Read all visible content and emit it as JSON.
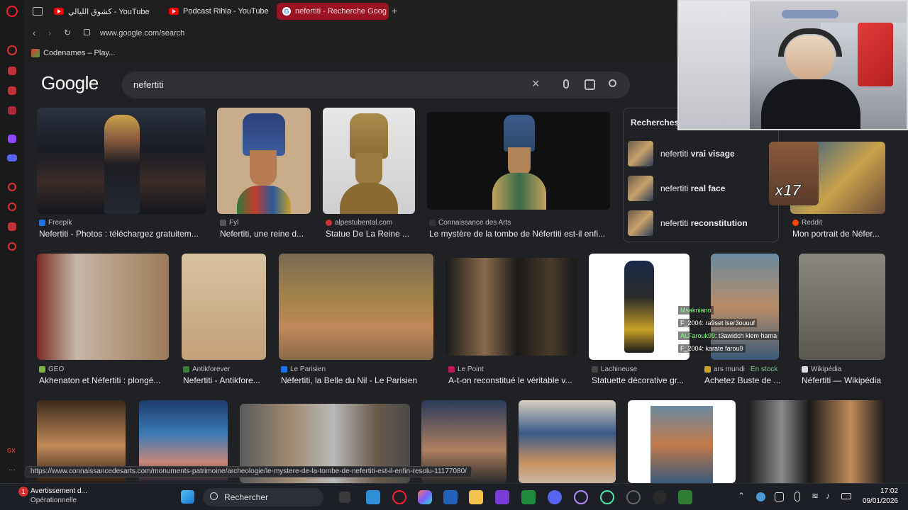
{
  "tabs": [
    {
      "label": "كشوق الليالي - YouTube",
      "icon": "youtube-icon"
    },
    {
      "label": "Podcast Rihla - YouTube",
      "icon": "youtube-icon"
    },
    {
      "label": "nefertiti - Recherche Goog",
      "icon": "google-icon"
    }
  ],
  "address": {
    "url": "www.google.com/search"
  },
  "bookmarks": [
    {
      "label": "Codenames – Play..."
    }
  ],
  "google": {
    "logo": "Google",
    "query": "nefertiti"
  },
  "related": {
    "title": "Recherches",
    "items": [
      {
        "prefix": "nefertiti ",
        "bold": "vrai visage"
      },
      {
        "prefix": "nefertiti ",
        "bold": "real face"
      },
      {
        "prefix": "nefertiti ",
        "bold": "reconstitution"
      }
    ]
  },
  "results_row1": [
    {
      "source": "Freepik",
      "caption": "Nefertiti - Photos : téléchargez gratuitem...",
      "fav": "#1a73e8"
    },
    {
      "source": "Fyl",
      "caption": "Nefertiti, une reine d...",
      "fav": "#555"
    },
    {
      "source": "alpestubental.com",
      "caption": "Statue De La Reine ...",
      "fav": "#c33"
    },
    {
      "source": "Connaissance des Arts",
      "caption": "Le mystère de la tombe de Néfertiti est-il enfi...",
      "fav": "#333"
    },
    {
      "source": "Reddit",
      "caption": "Mon portrait de Néfer...",
      "fav": "#ff4500"
    }
  ],
  "results_row2": [
    {
      "source": "GEO",
      "caption": "Akhenaton et Néfertiti : plongé...",
      "fav": "#7cb342"
    },
    {
      "source": "Antikforever",
      "caption": "Nefertiti - Antikfore...",
      "fav": "#3b7d3b"
    },
    {
      "source": "Le Parisien",
      "caption": "Néfertiti, la Belle du Nil - Le Parisien",
      "fav": "#1a73e8"
    },
    {
      "source": "Le Point",
      "caption": "A-t-on reconstitué le véritable v...",
      "fav": "#c2185b"
    },
    {
      "source": "Lachineuse",
      "caption": "Statuette décorative gr...",
      "fav": "#444"
    },
    {
      "source": "ars mundi",
      "stock": "En stock",
      "caption": "Achetez Buste de ...",
      "fav": "#c9a227"
    },
    {
      "source": "Wikipédia",
      "caption": "Néfertiti — Wikipédia",
      "fav": "#ddd"
    }
  ],
  "chat": [
    {
      "user": "Msakniano",
      "text": ""
    },
    {
      "user": "F_2004",
      "text": ": ra9set lser3ouuuf"
    },
    {
      "user": "ALFarouk99",
      "text": ": t3awidch klem hama"
    },
    {
      "user": "F_2004",
      "text": ": karate farou9"
    }
  ],
  "overlay_text": "x17",
  "status_url": "https://www.connaissancedesarts.com/monuments-patrimoine/archeologie/le-mystere-de-la-tombe-de-nefertiti-est-il-enfin-resolu-11177080/",
  "taskbar": {
    "notification_title": "Avertissement d...",
    "notification_sub": "Opérationnelle",
    "notification_count": "1",
    "search_placeholder": "Rechercher",
    "time": "17:02",
    "date": "09/01/2026"
  },
  "colors": {
    "accent_tab": "#9a1322",
    "background": "#202124",
    "opera_red": "#ff1b2d"
  }
}
